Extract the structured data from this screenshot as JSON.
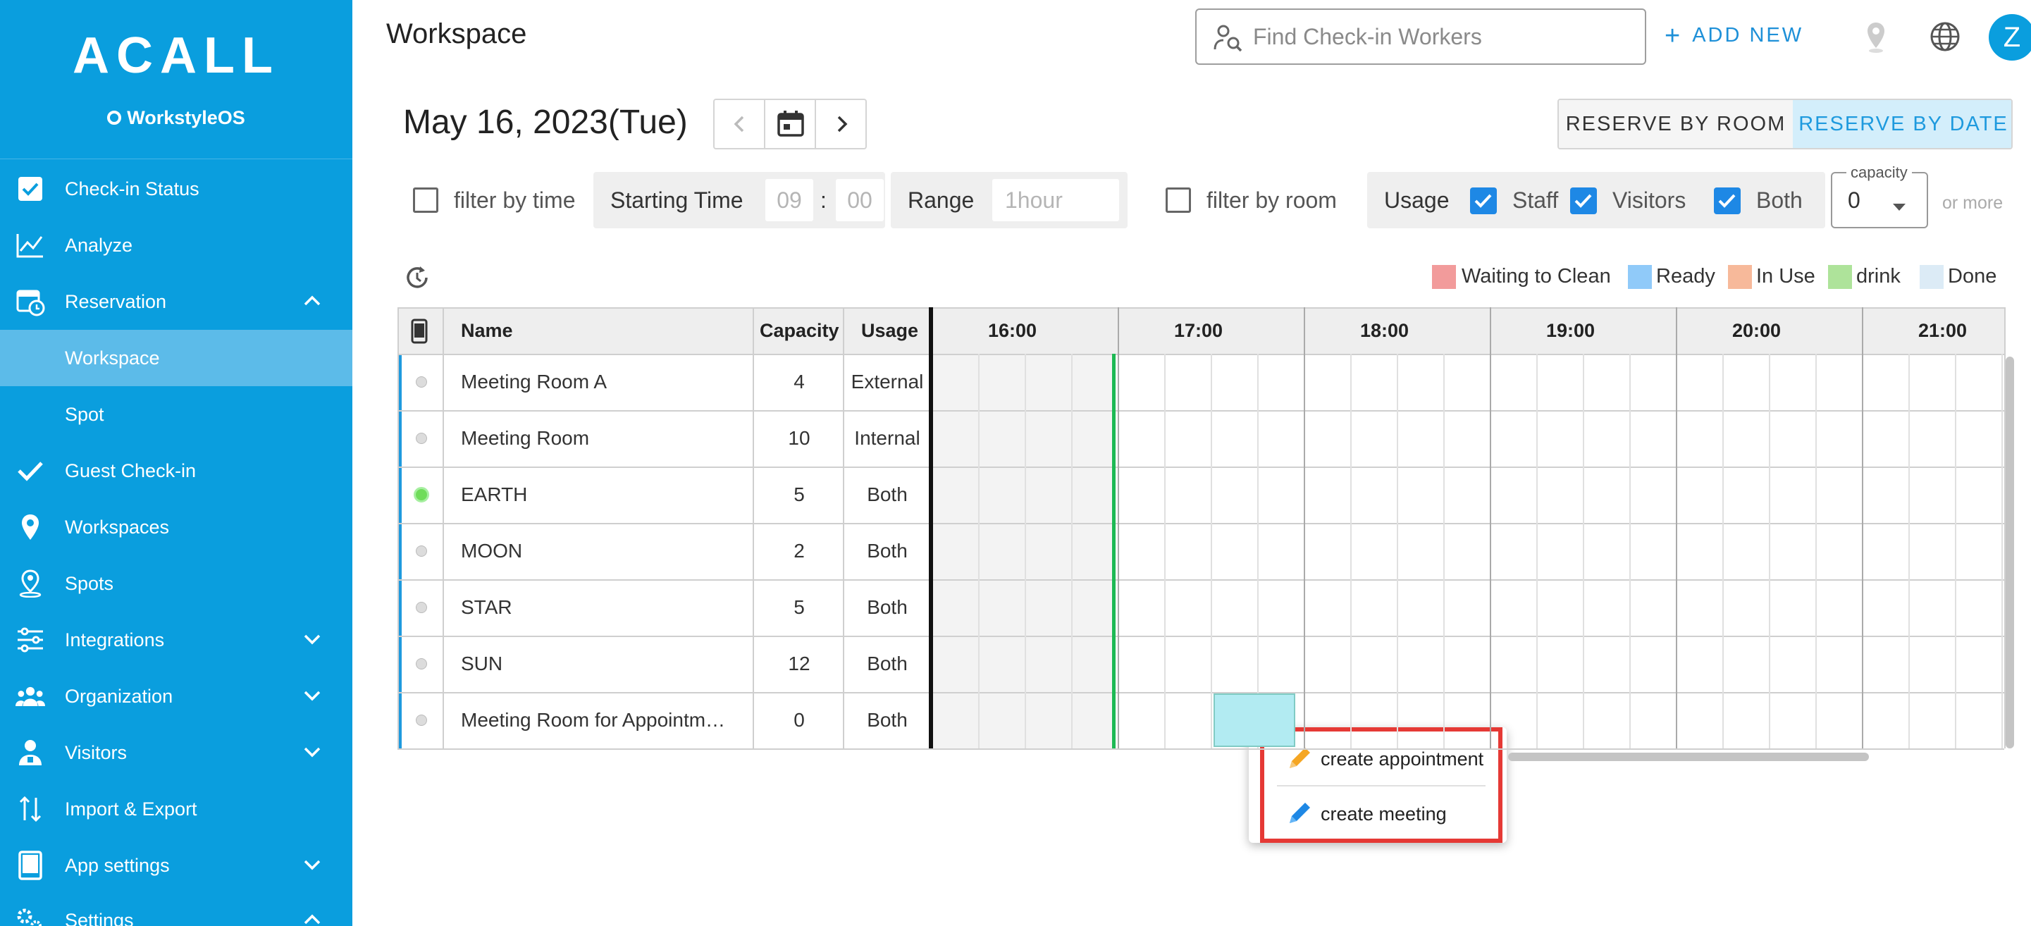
{
  "brand": {
    "logo": "ACALL",
    "product": "WorkstyleOS"
  },
  "sidebar": {
    "items": [
      {
        "label": "Check-in Status",
        "icon": "checkbox-icon"
      },
      {
        "label": "Analyze",
        "icon": "chart-line-icon"
      },
      {
        "label": "Reservation",
        "icon": "calendar-clock-icon",
        "expanded": true
      },
      {
        "label": "Workspace",
        "sub": true,
        "active": true
      },
      {
        "label": "Spot",
        "sub": true
      },
      {
        "label": "Guest Check-in",
        "icon": "check-icon"
      },
      {
        "label": "Workspaces",
        "icon": "map-pin-icon"
      },
      {
        "label": "Spots",
        "icon": "person-pin-icon"
      },
      {
        "label": "Integrations",
        "icon": "sliders-icon",
        "expandable": true
      },
      {
        "label": "Organization",
        "icon": "people-icon",
        "expandable": true
      },
      {
        "label": "Visitors",
        "icon": "person-badge-icon",
        "expandable": true
      },
      {
        "label": "Import & Export",
        "icon": "import-export-icon"
      },
      {
        "label": "App settings",
        "icon": "tablet-icon",
        "expandable": true
      },
      {
        "label": "Settings",
        "icon": "gears-icon",
        "expanded": true
      }
    ]
  },
  "header": {
    "title": "Workspace",
    "search_placeholder": "Find Check-in Workers",
    "add_new": "ADD NEW",
    "avatar_initial": "Z"
  },
  "datebar": {
    "date": "May 16, 2023(Tue)",
    "reserve_by_room": "RESERVE BY ROOM",
    "reserve_by_date": "RESERVE BY DATE"
  },
  "filters": {
    "filter_by_time": "filter by time",
    "starting_time_label": "Starting Time",
    "hour": "09",
    "colon": ":",
    "minute": "00",
    "range_label": "Range",
    "range_value": "1hour",
    "filter_by_room": "filter by room",
    "usage_label": "Usage",
    "staff": "Staff",
    "visitors": "Visitors",
    "both": "Both",
    "capacity_label": "capacity",
    "capacity_value": "0",
    "or_more": "or more"
  },
  "legend": [
    {
      "label": "Waiting to Clean",
      "color": "#f29b9b"
    },
    {
      "label": "Ready",
      "color": "#90caf9"
    },
    {
      "label": "In Use",
      "color": "#f7b99a"
    },
    {
      "label": "drink",
      "color": "#aee39a"
    },
    {
      "label": "Done",
      "color": "#dcebf6"
    }
  ],
  "table": {
    "headers": {
      "name": "Name",
      "capacity": "Capacity",
      "usage": "Usage"
    },
    "hours": [
      "16:00",
      "17:00",
      "18:00",
      "19:00",
      "20:00",
      "21:00"
    ],
    "rows": [
      {
        "name": "Meeting Room A",
        "capacity": "4",
        "usage": "External",
        "online": false
      },
      {
        "name": "Meeting Room",
        "capacity": "10",
        "usage": "Internal",
        "online": false
      },
      {
        "name": "EARTH",
        "capacity": "5",
        "usage": "Both",
        "online": true
      },
      {
        "name": "MOON",
        "capacity": "2",
        "usage": "Both",
        "online": false
      },
      {
        "name": "STAR",
        "capacity": "5",
        "usage": "Both",
        "online": false
      },
      {
        "name": "SUN",
        "capacity": "12",
        "usage": "Both",
        "online": false
      },
      {
        "name": "Meeting Room for Appointm…",
        "capacity": "0",
        "usage": "Both",
        "online": false
      }
    ]
  },
  "popup": {
    "create_appointment": "create appointment",
    "create_meeting": "create meeting"
  },
  "colors": {
    "sidebar": "#0a9ede",
    "accent": "#1e88e5",
    "now_line": "#1db954",
    "selection": "#b2ebf2"
  }
}
